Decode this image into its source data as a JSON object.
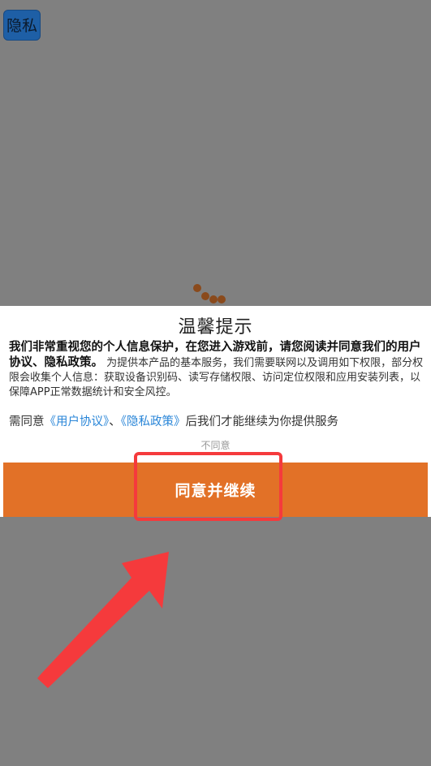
{
  "top_button": {
    "label": "隐私"
  },
  "dialog": {
    "title": "温馨提示",
    "body_bold": "我们非常重视您的个人信息保护，在您进入游戏前，请您阅读并同意我们的用户协议、隐私政策。",
    "body_text": "为提供本产品的基本服务，我们需要联网以及调用如下权限，部分权限会收集个人信息：获取设备识别码、读写存储权限、访问定位权限和应用安装列表，以保障APP正常数据统计和安全风控。",
    "consent_prefix": "需同意",
    "user_agreement_link": "《用户协议》",
    "consent_separator": "、",
    "privacy_policy_link": "《隐私政策》",
    "consent_suffix": "后我们才能继续为你提供服务",
    "disagree_label": "不同意",
    "agree_label": "同意并继续"
  },
  "colors": {
    "overlay": "#808080",
    "agree_button": "#e27127",
    "link": "#2a86d8",
    "annotation": "#f53a3c"
  }
}
